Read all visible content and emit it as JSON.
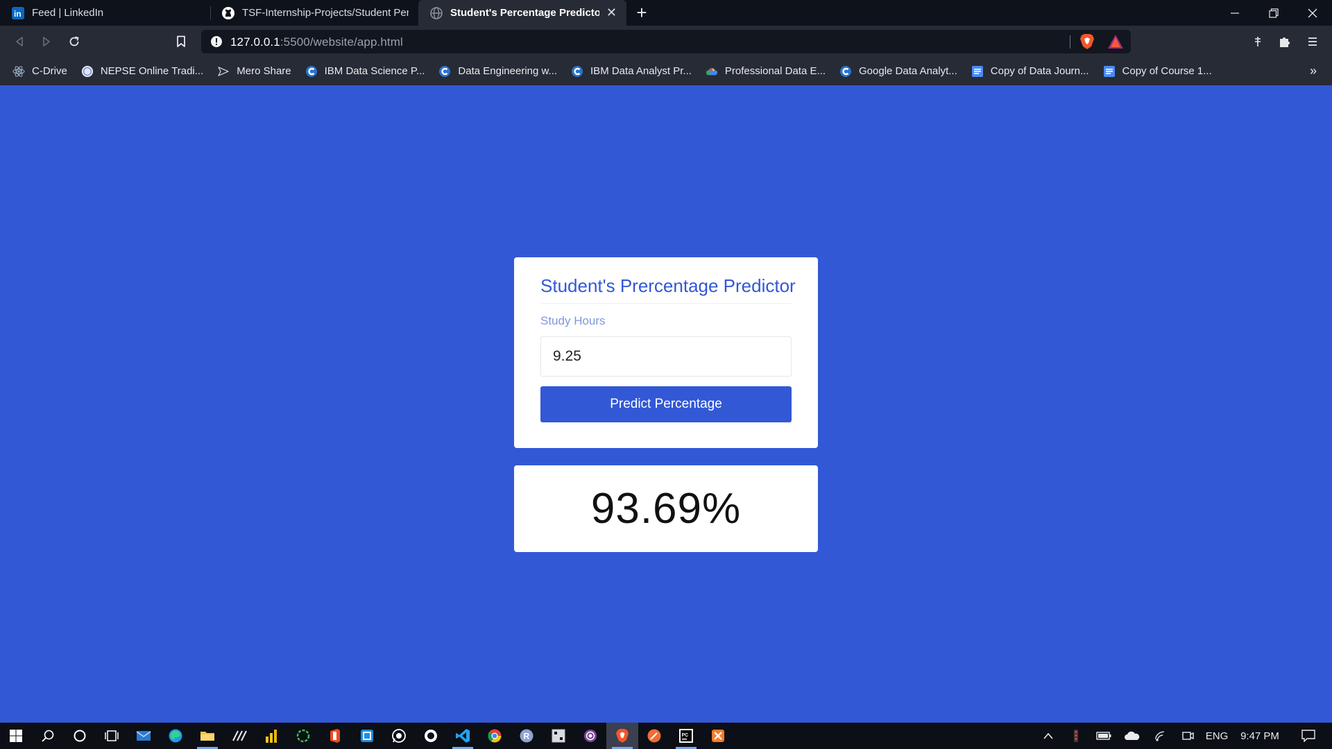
{
  "browser": {
    "tabs": [
      {
        "title": "Feed | LinkedIn",
        "icon": "linkedin-icon",
        "active": false
      },
      {
        "title": "TSF-Internship-Projects/Student Perce",
        "icon": "github-icon",
        "active": false
      },
      {
        "title": "Student's Percentage Predictor",
        "icon": "globe-icon",
        "active": true
      }
    ],
    "close_tab_glyph": "✕",
    "new_tab_glyph": "+",
    "url_host": "127.0.0.1",
    "url_path": ":5500/website/app.html",
    "bookmarks": [
      {
        "label": "C-Drive",
        "icon": "react-icon"
      },
      {
        "label": "NEPSE Online Tradi...",
        "icon": "nepse-icon"
      },
      {
        "label": "Mero Share",
        "icon": "meroshare-icon"
      },
      {
        "label": "IBM Data Science P...",
        "icon": "coursera-icon"
      },
      {
        "label": "Data Engineering w...",
        "icon": "coursera-icon"
      },
      {
        "label": "IBM Data Analyst Pr...",
        "icon": "coursera-icon"
      },
      {
        "label": "Professional Data E...",
        "icon": "google-cloud-icon"
      },
      {
        "label": "Google Data Analyt...",
        "icon": "coursera-icon"
      },
      {
        "label": "Copy of Data Journ...",
        "icon": "google-docs-icon"
      },
      {
        "label": "Copy of Course 1...",
        "icon": "google-docs-icon"
      }
    ],
    "bookmarks_more": "»"
  },
  "page": {
    "title": "Student's Prercentage Predictor",
    "field_label": "Study Hours",
    "field_value": "9.25",
    "button_label": "Predict Percentage",
    "result": "93.69%",
    "accent_color": "#3358d6"
  },
  "taskbar": {
    "language": "ENG",
    "time": "9:47 PM",
    "apps": [
      "start-icon",
      "search-icon",
      "cortana-icon",
      "task-view-icon",
      "mail-icon",
      "edge-icon",
      "file-explorer-icon",
      "app-icon",
      "power-bi-icon",
      "loading-app-icon",
      "office-icon",
      "app-icon",
      "whatsapp-icon",
      "app-icon",
      "vscode-icon",
      "chrome-icon",
      "r-icon",
      "app-icon",
      "tor-icon",
      "brave-icon",
      "postman-icon",
      "pycharm-icon",
      "xampp-icon"
    ]
  }
}
